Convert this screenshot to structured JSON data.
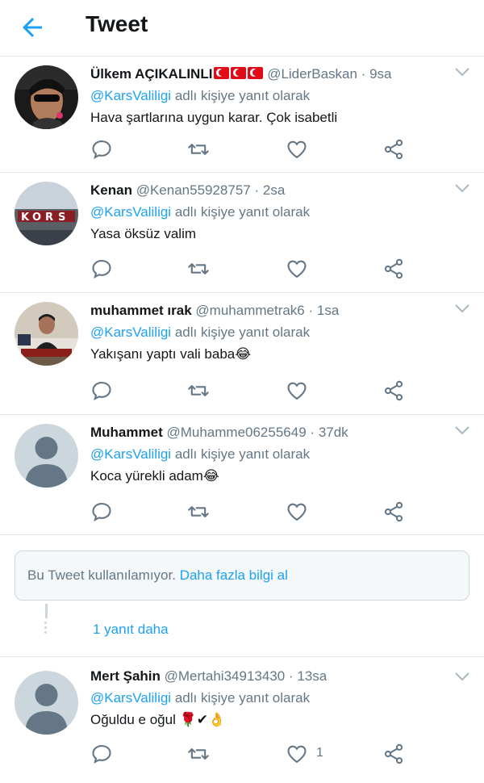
{
  "header": {
    "title": "Tweet"
  },
  "reply_prefix": "",
  "reply_suffix": "adlı kişiye yanıt olarak",
  "tweets": [
    {
      "name": "Ülkem AÇIKALINLI",
      "handle": "@LiderBaskan",
      "time": "9sa",
      "mention": "@KarsValiligi",
      "text": "Hava şartlarına uygun karar. Çok isabetli",
      "emoji": "",
      "like_count": ""
    },
    {
      "name": "Kenan",
      "handle": "@Kenan55928757",
      "time": "2sa",
      "mention": "@KarsValiligi",
      "text": "Yasa öksüz valim",
      "emoji": "",
      "like_count": ""
    },
    {
      "name": "muhammet ırak",
      "handle": "@muhammetrak6",
      "time": "1sa",
      "mention": "@KarsValiligi",
      "text": "Yakışanı yaptı vali baba",
      "emoji": "😂",
      "like_count": ""
    },
    {
      "name": "Muhammet",
      "handle": "@Muhamme06255649",
      "time": "37dk",
      "mention": "@KarsValiligi",
      "text": "Koca yürekli adam",
      "emoji": "😂",
      "like_count": ""
    },
    {
      "name": "Mert Şahin",
      "handle": "@Mertahi34913430",
      "time": "13sa",
      "mention": "@KarsValiligi",
      "text": "Oğuldu e oğul",
      "emoji": "🌹✔👌",
      "like_count": "1"
    }
  ],
  "unavailable": {
    "text": "Bu Tweet kullanılamıyor.",
    "link": "Daha fazla bilgi al"
  },
  "more_replies": "1 yanıt daha",
  "colors": {
    "accent": "#1da1f2",
    "secondary": "#657786",
    "divider": "#e1e8ed",
    "text": "#14171a"
  },
  "icons": [
    "back-arrow-icon",
    "chevron-down-icon",
    "reply-icon",
    "retweet-icon",
    "like-icon",
    "share-icon",
    "turkey-flag-icon"
  ]
}
